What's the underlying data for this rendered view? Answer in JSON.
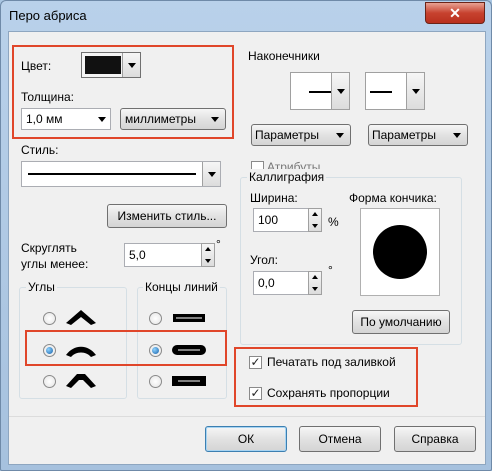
{
  "window": {
    "title": "Перо абриса",
    "close_glyph": "✕"
  },
  "color": {
    "label": "Цвет:",
    "value": "#111111"
  },
  "thickness": {
    "label": "Толщина:",
    "value": "1,0 мм",
    "unit": "миллиметры"
  },
  "style": {
    "label": "Стиль:",
    "edit_button": "Изменить стиль..."
  },
  "round_corners": {
    "label_line1": "Скруглять",
    "label_line2": "углы менее:",
    "value": "5,0",
    "unit_symbol": "°"
  },
  "corners_group": {
    "title": "Углы",
    "selected_index": 1
  },
  "line_ends_group": {
    "title": "Концы линий",
    "selected_index": 1
  },
  "arrowheads": {
    "title": "Наконечники",
    "options_left": "Параметры",
    "options_right": "Параметры",
    "attributes": "Атрибуты"
  },
  "calligraphy": {
    "title": "Каллиграфия",
    "width_label": "Ширина:",
    "width_value": "100",
    "width_unit": "%",
    "angle_label": "Угол:",
    "angle_value": "0,0",
    "angle_unit": "°",
    "nib_shape_label": "Форма кончика:",
    "default_button": "По умолчанию"
  },
  "checkboxes": {
    "behind_fill": {
      "label": "Печатать под заливкой",
      "checked": true
    },
    "scale_with_image": {
      "label": "Сохранять пропорции",
      "checked": true
    }
  },
  "buttons": {
    "ok": "ОК",
    "cancel": "Отмена",
    "help": "Справка"
  },
  "colors": {
    "highlight": "#e0462a",
    "title_bar": "#b9d1ea"
  }
}
